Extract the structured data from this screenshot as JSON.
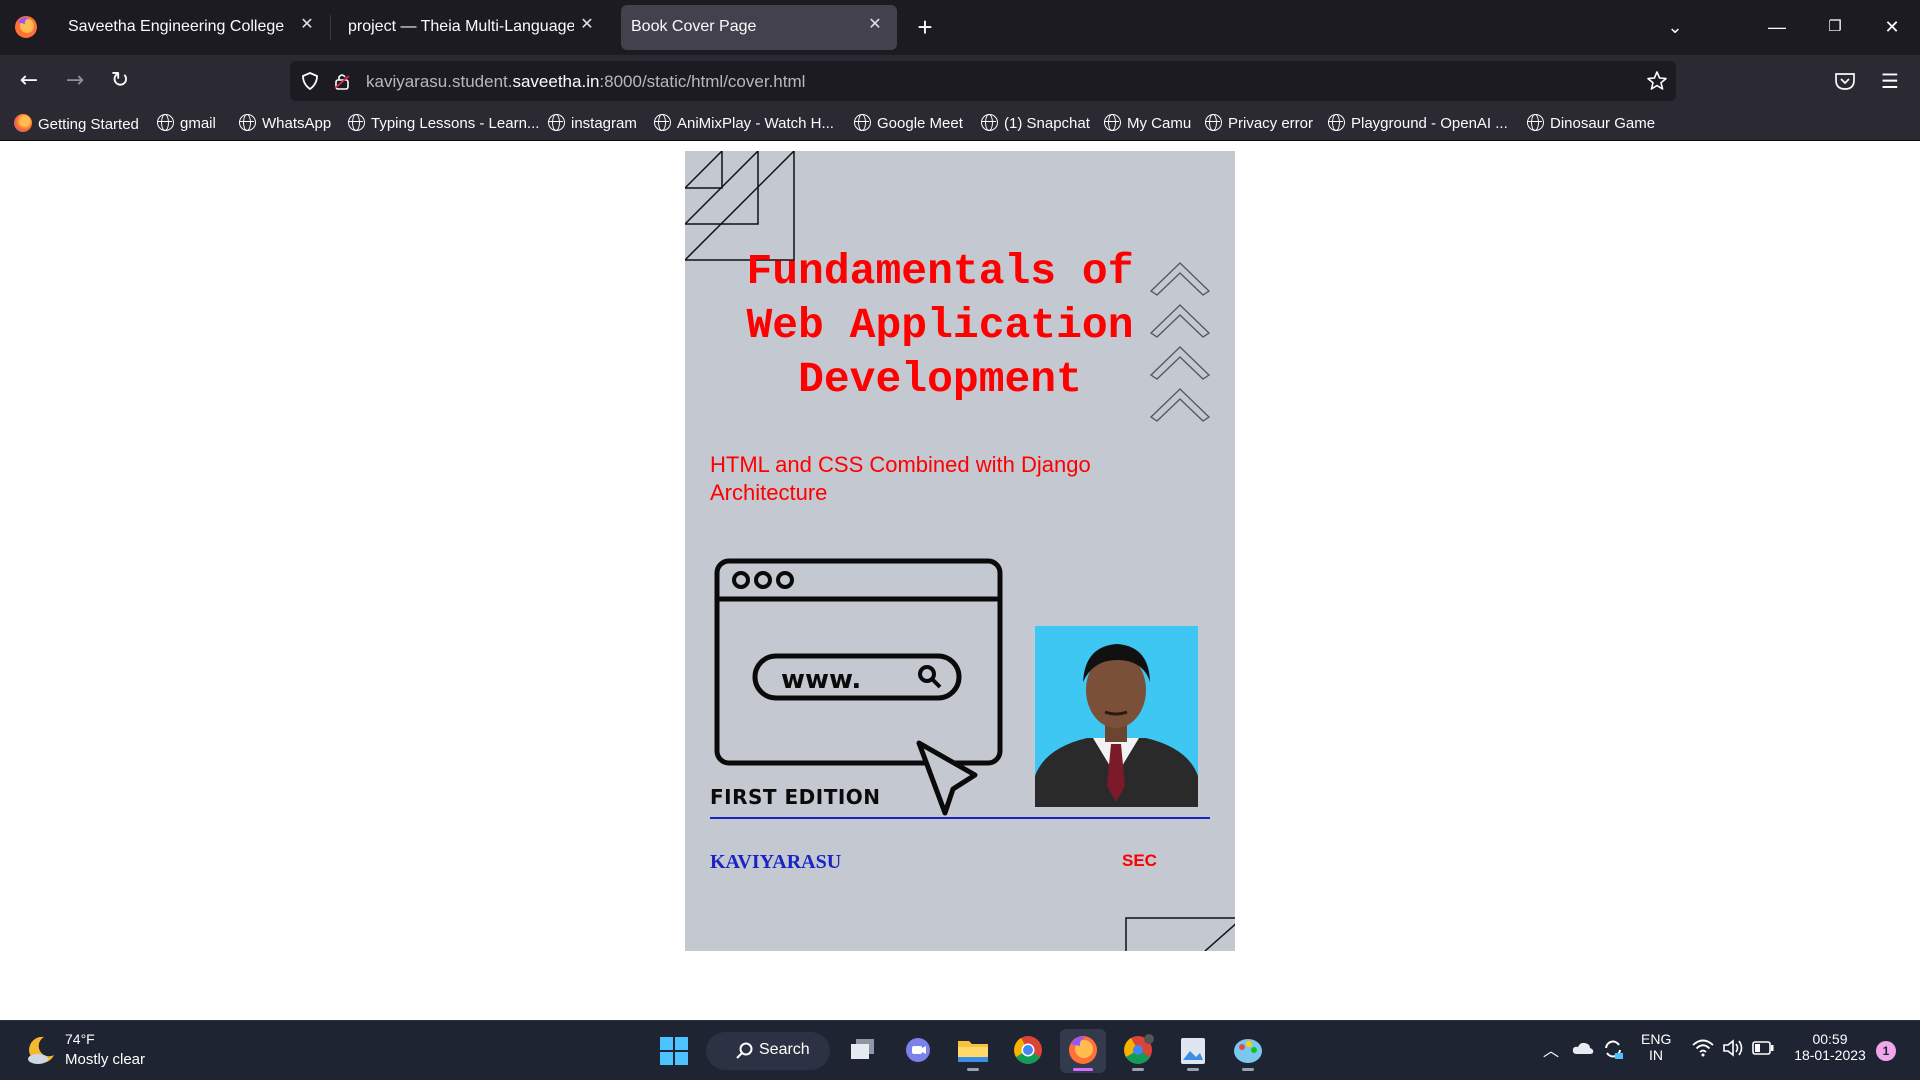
{
  "browser": {
    "tabs": [
      {
        "title": "Saveetha Engineering College",
        "active": false
      },
      {
        "title": "project — Theia Multi-Language Ex",
        "active": false
      },
      {
        "title": "Book Cover Page",
        "active": true
      }
    ],
    "url": {
      "prefix": "kaviyarasu.student.",
      "domain": "saveetha.in",
      "suffix": ":8000/static/html/cover.html"
    },
    "bookmarks": [
      {
        "label": "Getting Started",
        "icon": "firefox-icon"
      },
      {
        "label": "gmail",
        "icon": "globe-icon"
      },
      {
        "label": "WhatsApp",
        "icon": "globe-icon"
      },
      {
        "label": "Typing Lessons - Learn...",
        "icon": "globe-icon"
      },
      {
        "label": "instagram",
        "icon": "globe-icon"
      },
      {
        "label": "AniMixPlay - Watch H...",
        "icon": "globe-icon"
      },
      {
        "label": "Google Meet",
        "icon": "globe-icon"
      },
      {
        "label": "(1) Snapchat",
        "icon": "globe-icon"
      },
      {
        "label": "My Camu",
        "icon": "globe-icon"
      },
      {
        "label": "Privacy error",
        "icon": "globe-icon"
      },
      {
        "label": "Playground - OpenAI ...",
        "icon": "globe-icon"
      },
      {
        "label": "Dinosaur Game",
        "icon": "globe-icon"
      }
    ]
  },
  "cover": {
    "title_lines": [
      "Fundamentals of",
      "Web Application",
      "Development"
    ],
    "subtitle": "HTML and CSS Combined with Django Architecture",
    "illustration_text": "www.",
    "edition": "FIRST EDITION",
    "author": "KAVIYARASU",
    "publisher": "SEC",
    "colors": {
      "background": "#c3c8d1",
      "title": "#ff0000",
      "author": "#1a24c2",
      "rule": "#1a24c2"
    }
  },
  "taskbar": {
    "weather": {
      "temp": "74°F",
      "desc": "Mostly clear"
    },
    "search_label": "Search",
    "apps": [
      "windows-start",
      "task-view",
      "teams-chat",
      "file-explorer",
      "chrome",
      "firefox",
      "chrome-profile",
      "photos",
      "paint"
    ],
    "tray": {
      "lang_top": "ENG",
      "lang_bottom": "IN",
      "time": "00:59",
      "date": "18-01-2023",
      "notifications": "1"
    }
  }
}
